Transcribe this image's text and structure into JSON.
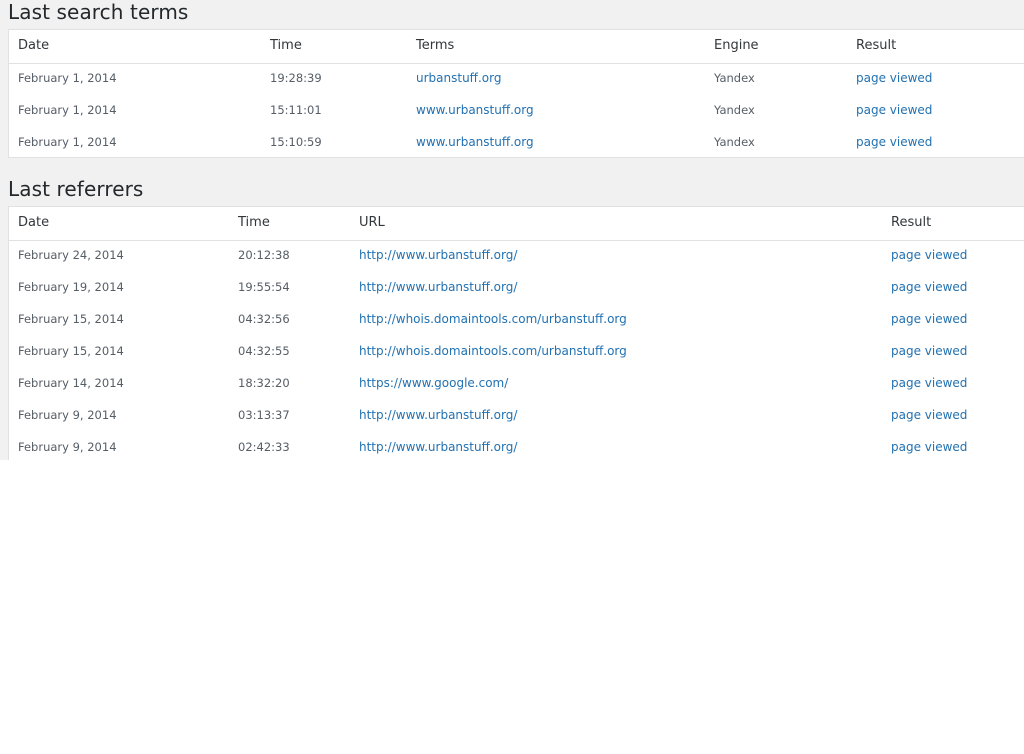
{
  "search_terms": {
    "title": "Last search terms",
    "columns": [
      "Date",
      "Time",
      "Terms",
      "Engine",
      "Result"
    ],
    "rows": [
      {
        "date": "February 1, 2014",
        "time": "19:28:39",
        "terms": "urbanstuff.org",
        "engine": "Yandex",
        "result": "page viewed"
      },
      {
        "date": "February 1, 2014",
        "time": "15:11:01",
        "terms": "www.urbanstuff.org",
        "engine": "Yandex",
        "result": "page viewed"
      },
      {
        "date": "February 1, 2014",
        "time": "15:10:59",
        "terms": "www.urbanstuff.org",
        "engine": "Yandex",
        "result": "page viewed"
      }
    ]
  },
  "referrers": {
    "title": "Last referrers",
    "columns": [
      "Date",
      "Time",
      "URL",
      "Result"
    ],
    "rows": [
      {
        "date": "February 24, 2014",
        "time": "20:12:38",
        "url": "http://www.urbanstuff.org/",
        "result": "page viewed"
      },
      {
        "date": "February 19, 2014",
        "time": "19:55:54",
        "url": "http://www.urbanstuff.org/",
        "result": "page viewed"
      },
      {
        "date": "February 15, 2014",
        "time": "04:32:56",
        "url": "http://whois.domaintools.com/urbanstuff.org",
        "result": "page viewed"
      },
      {
        "date": "February 15, 2014",
        "time": "04:32:55",
        "url": "http://whois.domaintools.com/urbanstuff.org",
        "result": "page viewed"
      },
      {
        "date": "February 14, 2014",
        "time": "18:32:20",
        "url": "https://www.google.com/",
        "result": "page viewed"
      },
      {
        "date": "February 9, 2014",
        "time": "03:13:37",
        "url": "http://www.urbanstuff.org/",
        "result": "page viewed"
      },
      {
        "date": "February 9, 2014",
        "time": "02:42:33",
        "url": "http://www.urbanstuff.org/",
        "result": "page viewed"
      }
    ]
  },
  "colors": {
    "link": "#2271b1",
    "panel_background": "#ffffff",
    "page_background": "#f1f1f1",
    "border": "#e1e1e1"
  }
}
